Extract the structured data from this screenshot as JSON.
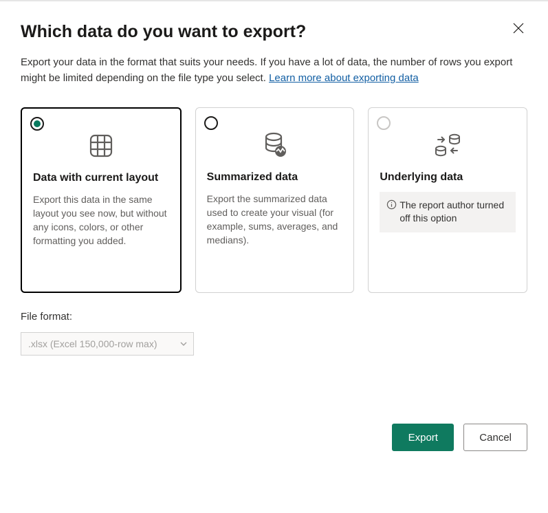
{
  "dialog": {
    "title": "Which data do you want to export?",
    "description_text": "Export your data in the format that suits your needs. If you have a lot of data, the number of rows you export might be limited depending on the file type you select.  ",
    "learn_more_link": "Learn more about exporting data"
  },
  "options": [
    {
      "title": "Data with current layout",
      "description": "Export this data in the same layout you see now, but without any icons, colors, or other formatting you added.",
      "selected": true,
      "disabled": false
    },
    {
      "title": "Summarized data",
      "description": "Export the summarized data used to create your visual (for example, sums, averages, and medians).",
      "selected": false,
      "disabled": false
    },
    {
      "title": "Underlying data",
      "description": "",
      "info_message": "The report author turned off this option",
      "selected": false,
      "disabled": true
    }
  ],
  "file_format": {
    "label": "File format:",
    "selected": ".xlsx (Excel 150,000-row max)"
  },
  "buttons": {
    "export": "Export",
    "cancel": "Cancel"
  }
}
